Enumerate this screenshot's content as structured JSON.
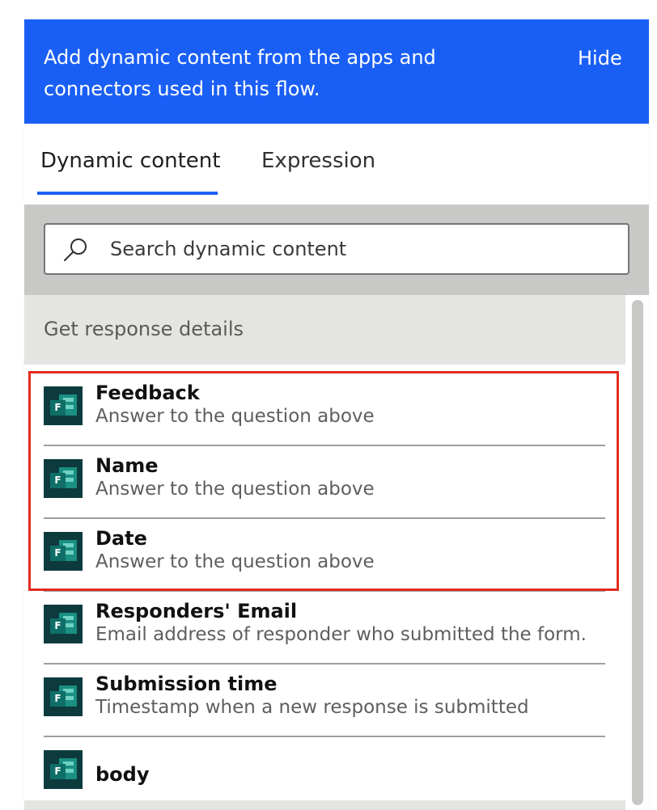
{
  "banner": {
    "text": "Add dynamic content from the apps and connectors used in this flow.",
    "hide_label": "Hide",
    "color": "#1a5ff5"
  },
  "tabs": [
    {
      "label": "Dynamic content",
      "active": true
    },
    {
      "label": "Expression",
      "active": false
    }
  ],
  "search": {
    "placeholder": "Search dynamic content",
    "value": "",
    "icon": "search-icon"
  },
  "section": {
    "title": "Get response details"
  },
  "items": [
    {
      "title": "Feedback",
      "description": "Answer to the question above",
      "icon": "microsoft-forms-icon",
      "highlighted": true
    },
    {
      "title": "Name",
      "description": "Answer to the question above",
      "icon": "microsoft-forms-icon",
      "highlighted": true
    },
    {
      "title": "Date",
      "description": "Answer to the question above",
      "icon": "microsoft-forms-icon",
      "highlighted": true
    },
    {
      "title": "Responders' Email",
      "description": "Email address of responder who submitted the form.",
      "icon": "microsoft-forms-icon",
      "highlighted": false
    },
    {
      "title": "Submission time",
      "description": "Timestamp when a new response is submitted",
      "icon": "microsoft-forms-icon",
      "highlighted": false
    },
    {
      "title": "body",
      "description": "",
      "icon": "microsoft-forms-icon",
      "highlighted": false
    }
  ],
  "highlight_color": "#e32b1e",
  "forms_icon_letter": "F"
}
